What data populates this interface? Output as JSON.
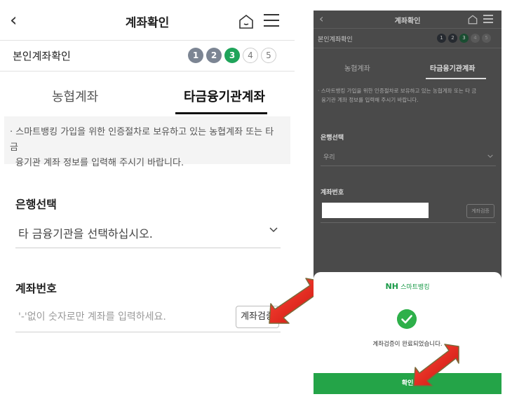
{
  "left_screen": {
    "header": {
      "back_glyph": "‹",
      "title": "계좌확인"
    },
    "steps": {
      "label": "본인계좌확인",
      "items": [
        "1",
        "2",
        "3",
        "4",
        "5"
      ]
    },
    "tabs": [
      {
        "label": "농협계좌"
      },
      {
        "label": "타금융기관계좌"
      }
    ],
    "notice": {
      "line1": "· 스마트뱅킹 가입을 위한 인증절차로 보유하고 있는 농협계좌 또는 타 금",
      "line2": "융기관 계좌 정보를 입력해 주시기 바랍니다."
    },
    "bank_select": {
      "label": "은행선택",
      "placeholder": "타 금융기관을 선택하십시오."
    },
    "account": {
      "label": "계좌번호",
      "placeholder": "'-'없이 숫자로만 계좌를 입력하세요.",
      "verify_button": "계좌검증"
    }
  },
  "right_screen": {
    "header": {
      "back_glyph": "‹",
      "title": "계좌확인"
    },
    "steps": {
      "label": "본인계좌확인",
      "items": [
        "1",
        "2",
        "3",
        "4",
        "5"
      ]
    },
    "tabs": [
      {
        "label": "농협계좌"
      },
      {
        "label": "타금융기관계좌"
      }
    ],
    "notice": {
      "line1": "· 스마트뱅킹 가입을 위한 인증절차로 보유하고 있는 농협계좌 또는 타 금",
      "line2": "융기관 계좌 정보를 입력해 주시기 바랍니다."
    },
    "bank_select": {
      "label": "은행선택",
      "value": "우리"
    },
    "account": {
      "label": "계좌번호",
      "verify_button": "계좌검증"
    },
    "dialog": {
      "brand_nh": "NH",
      "brand_sub": "스마트뱅킹",
      "message": "계좌검증이 완료되었습니다.",
      "confirm_button": "확인"
    }
  },
  "colors": {
    "accent_green": "#1fa45a",
    "step_done": "#7c8593",
    "arrow_red": "#e8231c",
    "dim_overlay": "#4a4a4a"
  }
}
